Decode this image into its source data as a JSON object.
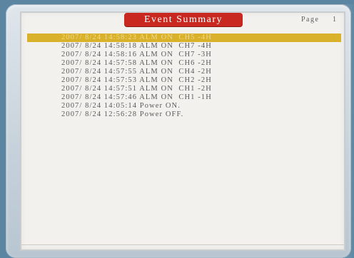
{
  "title": "Event Summary",
  "page": {
    "label": "Page",
    "number": "1"
  },
  "events": [
    {
      "text": "2007/ 8/24 14:58:23 ALM ON  CH5 -4H",
      "selected": true
    },
    {
      "text": "2007/ 8/24 14:58:18 ALM ON  CH7 -4H",
      "selected": false
    },
    {
      "text": "2007/ 8/24 14:58:16 ALM ON  CH7 -3H",
      "selected": false
    },
    {
      "text": "2007/ 8/24 14:57:58 ALM ON  CH6 -2H",
      "selected": false
    },
    {
      "text": "2007/ 8/24 14:57:55 ALM ON  CH4 -2H",
      "selected": false
    },
    {
      "text": "2007/ 8/24 14:57:53 ALM ON  CH2 -2H",
      "selected": false
    },
    {
      "text": "2007/ 8/24 14:57:51 ALM ON  CH1 -2H",
      "selected": false
    },
    {
      "text": "2007/ 8/24 14:57:46 ALM ON  CH1 -1H",
      "selected": false
    },
    {
      "text": "2007/ 8/24 14:05:14 Power ON.",
      "selected": false
    },
    {
      "text": "2007/ 8/24 12:56:28 Power OFF.",
      "selected": false
    }
  ],
  "colors": {
    "title_background": "#c8281f",
    "selection_highlight": "#d9b12a",
    "screen_background": "#f3f1ed",
    "bezel": "#c5d1da"
  }
}
